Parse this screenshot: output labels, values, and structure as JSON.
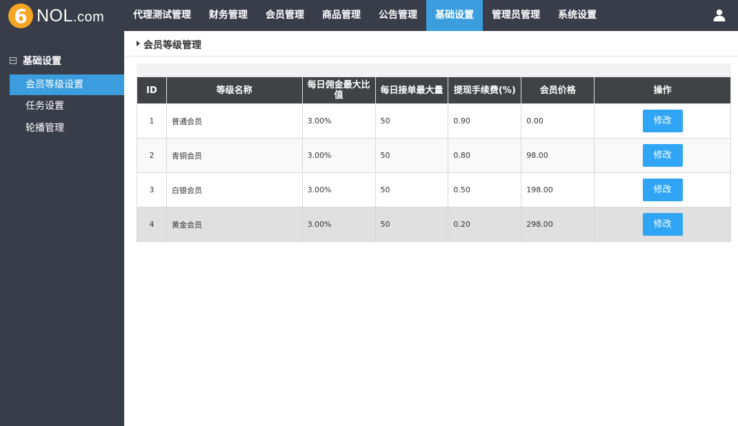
{
  "logo": {
    "digit": "6",
    "name": "NOL",
    "suffix": ".com"
  },
  "nav": {
    "items": [
      {
        "label": "代理测试管理"
      },
      {
        "label": "财务管理"
      },
      {
        "label": "会员管理"
      },
      {
        "label": "商品管理"
      },
      {
        "label": "公告管理"
      },
      {
        "label": "基础设置",
        "active": true
      },
      {
        "label": "管理员管理"
      },
      {
        "label": "系统设置"
      }
    ],
    "user_icon": "user-icon"
  },
  "sidebar": {
    "group_label": "基础设置",
    "items": [
      {
        "label": "会员等级设置",
        "active": true
      },
      {
        "label": "任务设置"
      },
      {
        "label": "轮播管理"
      }
    ]
  },
  "breadcrumb": {
    "title": "会员等级管理"
  },
  "table": {
    "headers": [
      "ID",
      "等级名称",
      "每日佣金最大比值",
      "每日接单最大量",
      "提现手续费(%)",
      "会员价格",
      "操作"
    ],
    "rows": [
      {
        "id": "1",
        "name": "普通会员",
        "ratio": "3.00%",
        "max_orders": "50",
        "fee": "0.90",
        "price": "0.00",
        "action": "修改"
      },
      {
        "id": "2",
        "name": "青铜会员",
        "ratio": "3.00%",
        "max_orders": "50",
        "fee": "0.80",
        "price": "98.00",
        "action": "修改"
      },
      {
        "id": "3",
        "name": "白银会员",
        "ratio": "3.00%",
        "max_orders": "50",
        "fee": "0.50",
        "price": "198.00",
        "action": "修改"
      },
      {
        "id": "4",
        "name": "黄金会员",
        "ratio": "3.00%",
        "max_orders": "50",
        "fee": "0.20",
        "price": "298.00",
        "action": "修改"
      }
    ]
  },
  "colors": {
    "nav_bg": "#393d49",
    "accent": "#3b9ddd",
    "button": "#30a5f5",
    "logo": "#f6a623",
    "table_header": "#414246"
  }
}
